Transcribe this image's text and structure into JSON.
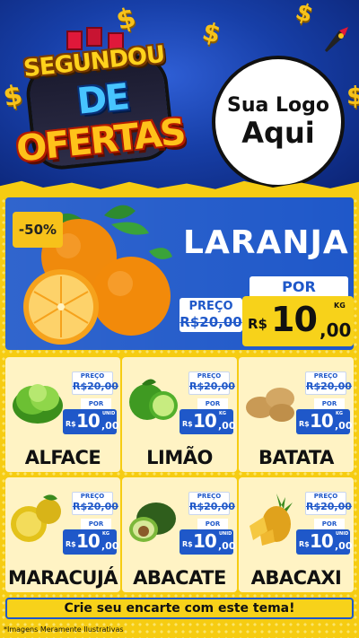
{
  "header": {
    "title_line1": "SEGUNDOU",
    "title_line2": "DE",
    "title_line3": "OFERTAS",
    "logo_line1": "Sua Logo",
    "logo_line2": "Aqui",
    "dollar_symbol": "$"
  },
  "featured": {
    "discount_badge": "-50%",
    "name": "LARANJA",
    "preco_label": "PREÇO",
    "old_price": "R$20,00",
    "por_label": "POR",
    "currency": "R$",
    "new_price_int": "10",
    "new_price_cents": ",00",
    "unit": "KG"
  },
  "products": [
    {
      "name": "ALFACE",
      "preco_label": "PREÇO",
      "old_price": "R$20,00",
      "por_label": "POR",
      "currency": "R$",
      "price_int": "10",
      "price_cents": ",00",
      "unit": "UNID"
    },
    {
      "name": "LIMÃO",
      "preco_label": "PREÇO",
      "old_price": "R$20,00",
      "por_label": "POR",
      "currency": "R$",
      "price_int": "10",
      "price_cents": ",00",
      "unit": "KG"
    },
    {
      "name": "BATATA",
      "preco_label": "PREÇO",
      "old_price": "R$20,00",
      "por_label": "POR",
      "currency": "R$",
      "price_int": "10",
      "price_cents": ",00",
      "unit": "KG"
    },
    {
      "name": "MARACUJÁ",
      "preco_label": "PREÇO",
      "old_price": "R$20,00",
      "por_label": "POR",
      "currency": "R$",
      "price_int": "10",
      "price_cents": ",00",
      "unit": "KG"
    },
    {
      "name": "ABACATE",
      "preco_label": "PREÇO",
      "old_price": "R$20,00",
      "por_label": "POR",
      "currency": "R$",
      "price_int": "10",
      "price_cents": ",00",
      "unit": "UNID"
    },
    {
      "name": "ABACAXI",
      "preco_label": "PREÇO",
      "old_price": "R$20,00",
      "por_label": "POR",
      "currency": "R$",
      "price_int": "10",
      "price_cents": ",00",
      "unit": "UNID"
    }
  ],
  "footer": {
    "cta": "Crie seu encarte com este tema!",
    "disclaimer": "*Imagens Meramente Ilustrativas"
  },
  "colors": {
    "blue": "#1f58c9",
    "yellow": "#f6cc12",
    "header_blue": "#173fa8"
  }
}
